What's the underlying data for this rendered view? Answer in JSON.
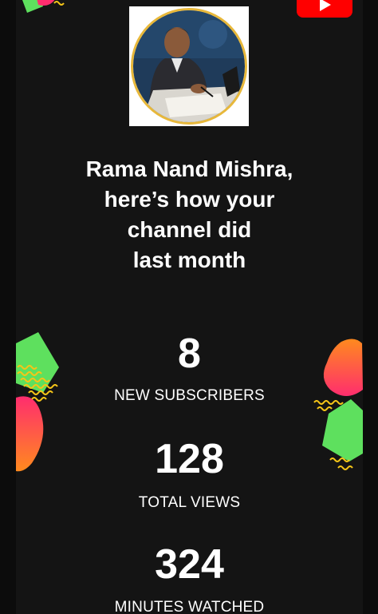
{
  "header": {
    "logo_icon": "youtube-play-icon",
    "brand_color": "#ff0000"
  },
  "profile": {
    "avatar_ring_color": "#e8b83a"
  },
  "headline": {
    "line1": "Rama Nand Mishra,",
    "line2": "here’s how your",
    "line3": "channel did",
    "line4": "last month"
  },
  "stats": [
    {
      "value": "8",
      "label": "NEW SUBSCRIBERS"
    },
    {
      "value": "128",
      "label": "TOTAL VIEWS"
    },
    {
      "value": "324",
      "label": "MINUTES WATCHED"
    }
  ],
  "decor": {
    "green": "#5ee05e",
    "pink": "#ff2d6e",
    "orange": "#ff8a1e",
    "yellow": "#f5c518"
  }
}
